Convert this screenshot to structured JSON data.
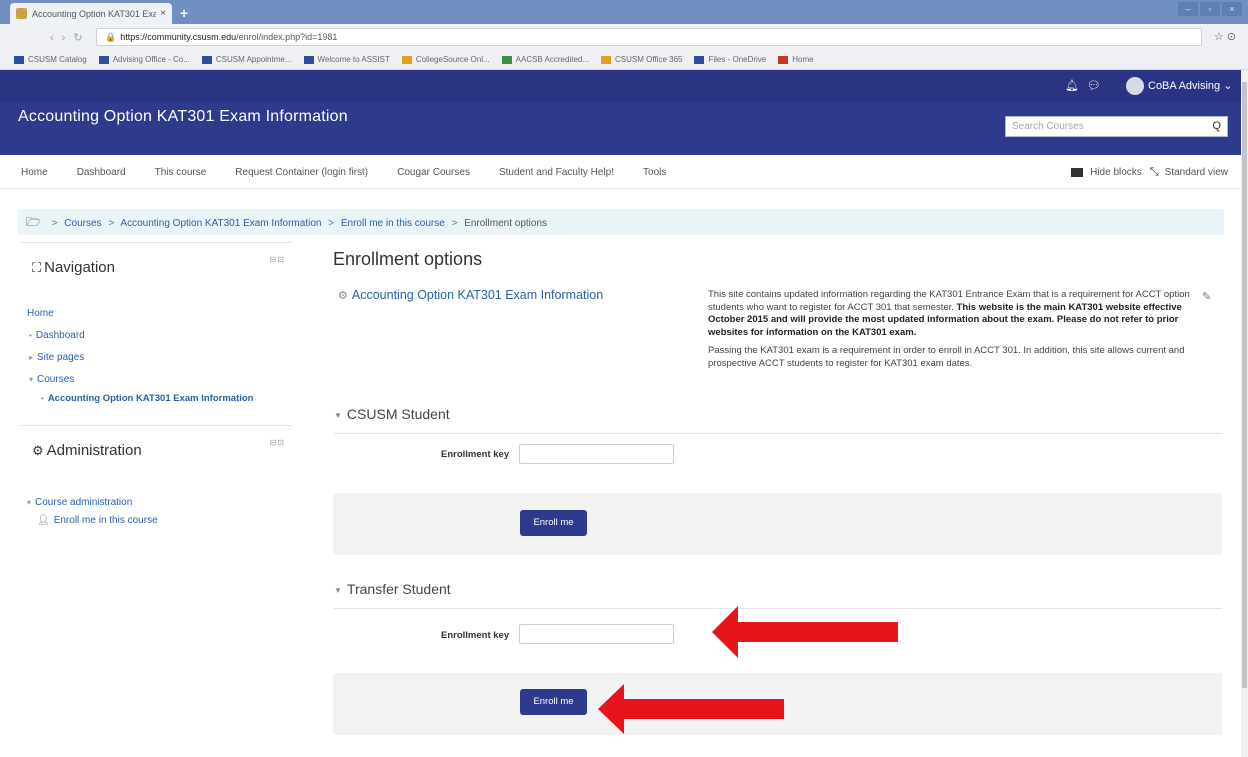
{
  "browser": {
    "tab_title": "Accounting Option KAT301 Exa",
    "tab_close": "×",
    "new_tab": "+",
    "url_host": "https://community.csusm.edu",
    "url_path": "/enrol/index.php?id=1981",
    "bookmarks": [
      "CSUSM Catalog",
      "Advising Office - Co...",
      "CSUSM Appointme...",
      "Welcome to ASSIST",
      "CollegeSource Onl...",
      "AACSB Accredited...",
      "CSUSM Office 365",
      "Files - OneDrive",
      "Home"
    ]
  },
  "header": {
    "user_name": "CoBA Advising ⌄",
    "course_title": "Accounting Option KAT301 Exam Information",
    "search_placeholder": "Search Courses",
    "search_icon": "Q"
  },
  "menu": {
    "items": [
      "Home",
      "Dashboard",
      "This course",
      "Request Container (login first)",
      "Cougar Courses",
      "Student and Faculty Help!",
      "Tools"
    ],
    "hide_blocks": "Hide blocks",
    "standard_view": "Standard view"
  },
  "breadcrumb": {
    "items": [
      "Courses",
      "Accounting Option KAT301 Exam Information",
      "Enroll me in this course",
      "Enrollment options"
    ],
    "separator": ">"
  },
  "navigation": {
    "title": "Navigation",
    "controls": "⊟⊡",
    "home": "Home",
    "dashboard": "Dashboard",
    "site_pages": "Site pages",
    "courses": "Courses",
    "current_course": "Accounting Option KAT301 Exam Information"
  },
  "administration": {
    "title": "Administration",
    "controls": "⊟⊡",
    "course_admin": "Course administration",
    "enroll_me": "Enroll me in this course"
  },
  "main": {
    "title": "Enrollment options",
    "course_link": "Accounting Option KAT301 Exam Information",
    "summary_p1_a": "This site contains updated information regarding the KAT301 Entrance Exam that is a requirement for ACCT option students who want to register for ACCT 301 that semester. ",
    "summary_p1_b": "This website is the main KAT301 website effective October 2015 and will provide the most updated information about the exam. Please do not refer to prior websites for information on the KAT301 exam.",
    "summary_p2": "Passing the KAT301 exam is a requirement in order to enroll in ACCT 301. In addition, this site allows current and prospective ACCT students to register for KAT301 exam dates.",
    "sections": [
      {
        "title": "CSUSM Student",
        "key_label": "Enrollment key",
        "key_value": "",
        "button": "Enroll me"
      },
      {
        "title": "Transfer Student",
        "key_label": "Enrollment key",
        "key_value": "",
        "button": "Enroll me"
      }
    ]
  },
  "colors": {
    "brand_dark": "#2b3482",
    "brand": "#2e3a8c",
    "link": "#2a5fa8",
    "annotation_arrow": "#e8141b"
  }
}
